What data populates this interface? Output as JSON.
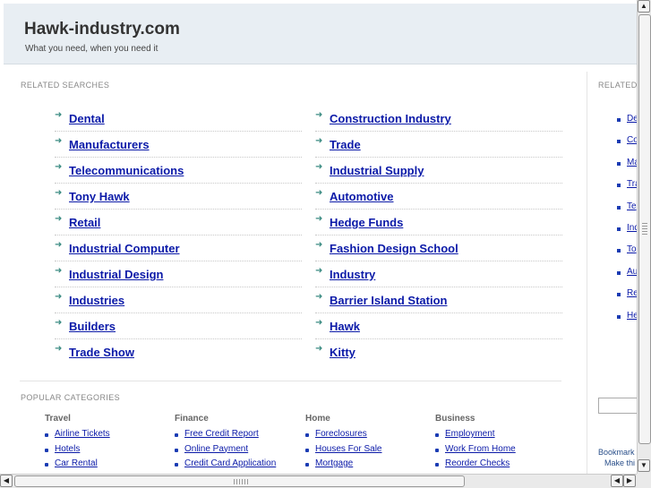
{
  "header": {
    "title": "Hawk-industry.com",
    "tagline": "What you need, when you need it"
  },
  "related": {
    "label": "RELATED SEARCHES",
    "left": [
      "Dental",
      "Manufacturers",
      "Telecommunications",
      "Tony Hawk",
      "Retail",
      "Industrial Computer",
      "Industrial Design",
      "Industries",
      "Builders",
      "Trade Show"
    ],
    "right": [
      "Construction Industry",
      "Trade",
      "Industrial Supply",
      "Automotive",
      "Hedge Funds",
      "Fashion Design School",
      "Industry",
      "Barrier Island Station",
      "Hawk",
      "Kitty"
    ]
  },
  "popular": {
    "label": "POPULAR CATEGORIES",
    "columns": [
      {
        "heading": "Travel",
        "items": [
          "Airline Tickets",
          "Hotels",
          "Car Rental"
        ]
      },
      {
        "heading": "Finance",
        "items": [
          "Free Credit Report",
          "Online Payment",
          "Credit Card Application"
        ]
      },
      {
        "heading": "Home",
        "items": [
          "Foreclosures",
          "Houses For Sale",
          "Mortgage"
        ]
      },
      {
        "heading": "Business",
        "items": [
          "Employment",
          "Work From Home",
          "Reorder Checks"
        ]
      }
    ]
  },
  "side": {
    "label": "RELATED",
    "items": [
      "De",
      "Co",
      "Ma",
      "Tra",
      "Te",
      "Ind",
      "To",
      "Au",
      "Re",
      "He"
    ],
    "bookmark": "Bookmark",
    "make": "Make thi"
  },
  "icons": {
    "arrow": "arrow-right-icon",
    "bullet": "bullet-icon"
  },
  "colors": {
    "link": "#0b1aa8",
    "arrow": "#3a8b82",
    "header_bg": "#e8eef3"
  }
}
